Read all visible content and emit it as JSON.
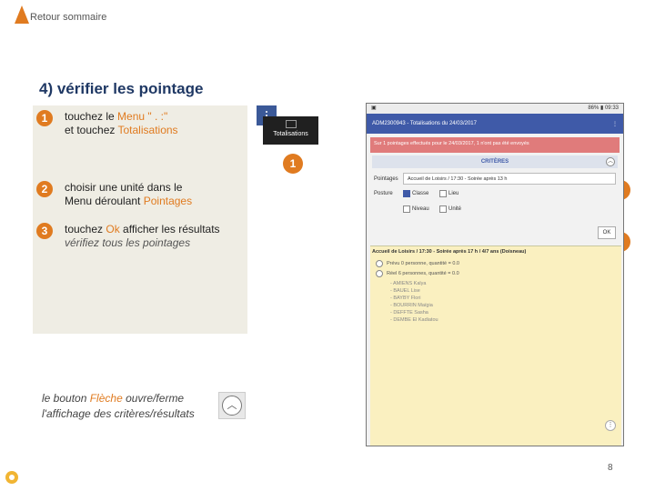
{
  "header": {
    "back_label": "Retour sommaire"
  },
  "slide": {
    "title": "4) vérifier les pointage",
    "page_number": "8"
  },
  "steps": [
    {
      "num": "1",
      "pre": "touchez le ",
      "hl1": "Menu \" . :\"",
      "mid": "et touchez ",
      "hl2": "Totalisations"
    },
    {
      "num": "2",
      "pre": "choisir une unité dans le Menu déroulant ",
      "hl": "Pointages"
    },
    {
      "num": "3",
      "pre": "touchez ",
      "hl": "Ok",
      "post": " afficher les résultats",
      "sub": "vérifiez tous les pointages"
    }
  ],
  "thumbnails": {
    "totalisations_label": "Totalisations"
  },
  "badges": [
    "1",
    "2",
    "3"
  ],
  "phone": {
    "status_left": "▣",
    "status_right": "86% ▮ 09:33",
    "app_title": "ADM2300943 - Totalisations du 24/03/2017",
    "alert": "Sur 1 pointages effectués pour le 24/03/2017, 1 n'ont pas été envoyés",
    "criteria_label": "CRITÈRES",
    "pointages_label": "Pointages",
    "pointages_value": "Accueil de Loisirs / 17:30 - Soirée après 13 h",
    "posture_label": "Posture",
    "options": [
      {
        "label": "Classe",
        "checked": true
      },
      {
        "label": "Lieu",
        "checked": false
      },
      {
        "label": "Niveau",
        "checked": false
      },
      {
        "label": "Unité",
        "checked": false
      }
    ],
    "ok_label": "OK",
    "results_title": "Accueil de Loisirs / 17:30 - Soirée après 17 h / 4/7 ans (Doisneau)",
    "line1": "Prévu 0 personne, quantité = 0.0",
    "line2": "Réel 6 personnes, quantité = 0.0",
    "names": [
      "- AMIENS Kalya",
      "- BAUEL Lise",
      "- BAYBY Flori",
      "- BOURRIN Maïgia",
      "- DEFFTE Sasha",
      "- DEMBE El Kadiatou"
    ]
  },
  "note": {
    "line1_pre": "le bouton ",
    "line1_hl": "Flèche",
    "line1_post": " ouvre/ferme",
    "line2": "l'affichage des critères/résultats"
  },
  "colors": {
    "accent": "#e07b20",
    "title": "#1f3864",
    "panel": "#efede4",
    "app_bar": "#3f5aa8"
  }
}
